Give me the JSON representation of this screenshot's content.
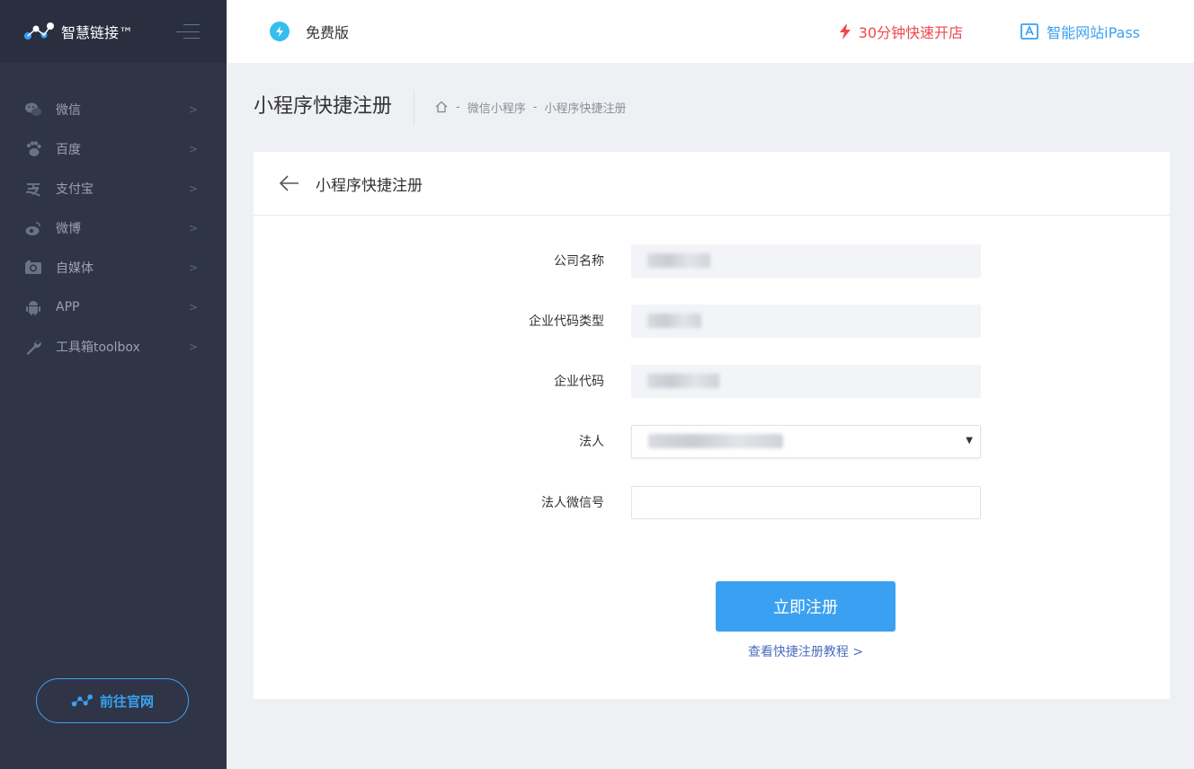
{
  "brand": {
    "name": "智慧链接™"
  },
  "sidebar": {
    "items": [
      {
        "label": "微信",
        "icon": "wechat-icon"
      },
      {
        "label": "百度",
        "icon": "paw-icon"
      },
      {
        "label": "支付宝",
        "icon": "alipay-icon"
      },
      {
        "label": "微博",
        "icon": "weibo-icon"
      },
      {
        "label": "自媒体",
        "icon": "camera-icon"
      },
      {
        "label": "APP",
        "icon": "android-icon"
      },
      {
        "label": "工具箱toolbox",
        "icon": "wrench-icon"
      }
    ],
    "chevron": ">",
    "official_site": "前往官网"
  },
  "topbar": {
    "plan": "免费版",
    "quick_open": "30分钟快速开店",
    "ipass": "智能网站iPass"
  },
  "page": {
    "title": "小程序快捷注册",
    "breadcrumb": [
      "微信小程序",
      "小程序快捷注册"
    ],
    "breadcrumb_sep": "-"
  },
  "card": {
    "title": "小程序快捷注册",
    "fields": [
      {
        "label": "公司名称"
      },
      {
        "label": "企业代码类型"
      },
      {
        "label": "企业代码"
      },
      {
        "label": "法人"
      },
      {
        "label": "法人微信号",
        "value": ""
      }
    ],
    "submit": "立即注册",
    "tutorial_link": "查看快捷注册教程 >"
  },
  "colors": {
    "sidebar_bg": "#2f3546",
    "accent": "#3aa1f2",
    "promo_red": "#f0474b"
  }
}
